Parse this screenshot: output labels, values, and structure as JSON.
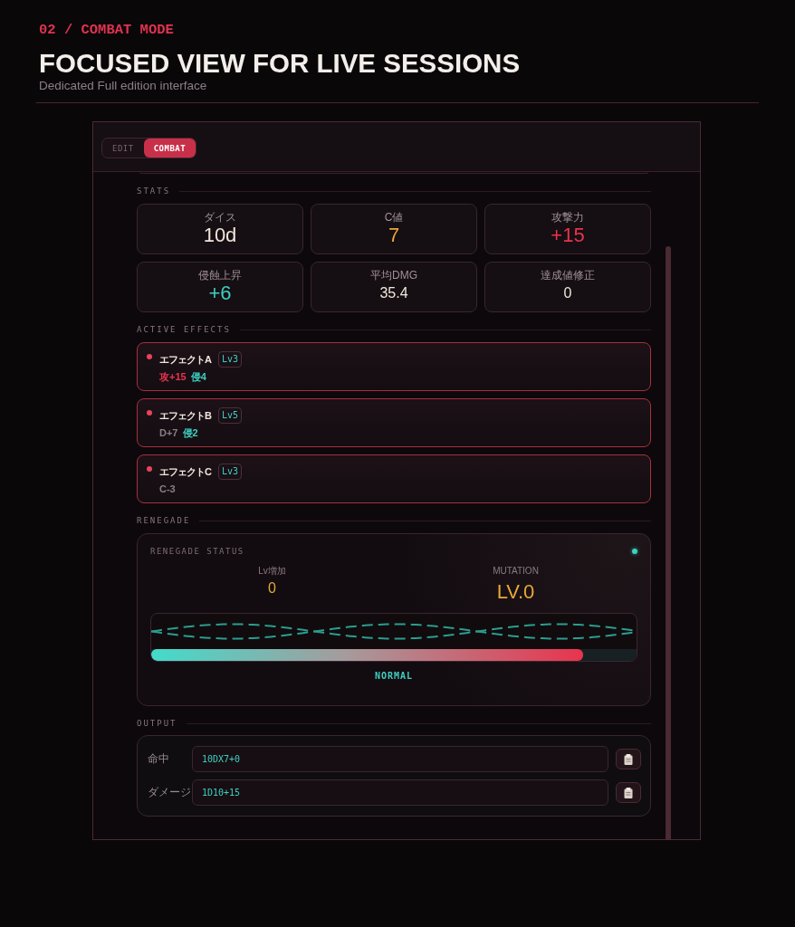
{
  "header": {
    "eyebrow": "02 / COMBAT MODE",
    "title": "FOCUSED VIEW FOR LIVE SESSIONS",
    "subtitle": "Dedicated Full edition interface"
  },
  "mode_toggle": [
    {
      "label": "EDIT",
      "selected": false
    },
    {
      "label": "COMBAT",
      "selected": true
    }
  ],
  "stats": {
    "title": "STATS",
    "items": [
      {
        "label": "ダイス",
        "value": "10d",
        "kind": "large",
        "color": "#f0e6dc"
      },
      {
        "label": "C値",
        "value": "7",
        "kind": "large",
        "color": "#e8a838"
      },
      {
        "label": "攻撃力",
        "value": "+15",
        "kind": "large",
        "color": "#e8344e"
      },
      {
        "label": "侵蝕上昇",
        "value": "+6",
        "kind": "large",
        "color": "#3ecfc0"
      },
      {
        "label": "平均DMG",
        "value": "35.4",
        "kind": "small",
        "color": "#f0e6dc"
      },
      {
        "label": "達成値修正",
        "value": "0",
        "kind": "small",
        "color": "#f0e6dc"
      }
    ]
  },
  "active_effects": {
    "title": "ACTIVE EFFECTS",
    "items": [
      {
        "name": "エフェクトA",
        "badge": "Lv3",
        "modifiers": [
          {
            "text": "攻+15",
            "color": "#e8344e"
          },
          {
            "text": "侵4",
            "color": "#3ecfc0"
          }
        ]
      },
      {
        "name": "エフェクトB",
        "badge": "Lv5",
        "modifiers": [
          {
            "text": "D+7",
            "color": "#8a7e86"
          },
          {
            "text": "侵2",
            "color": "#3ecfc0"
          }
        ]
      },
      {
        "name": "エフェクトC",
        "badge": "Lv3",
        "modifiers": [
          {
            "text": "C-3",
            "color": "#8a7e86"
          }
        ]
      }
    ]
  },
  "renegade": {
    "title": "RENEGADE",
    "status_title": "RENEGADE STATUS",
    "metrics": [
      {
        "label": "Lv増加",
        "value": "0",
        "kind": "small"
      },
      {
        "label": "MUTATION",
        "value": "LV.0",
        "kind": "large"
      }
    ],
    "level": 0.89,
    "state": "NORMAL"
  },
  "output": {
    "title": "OUTPUT",
    "rows": [
      {
        "label": "命中",
        "value": "10DX7+0"
      },
      {
        "label": "ダメージ",
        "value": "1D10+15"
      }
    ]
  }
}
